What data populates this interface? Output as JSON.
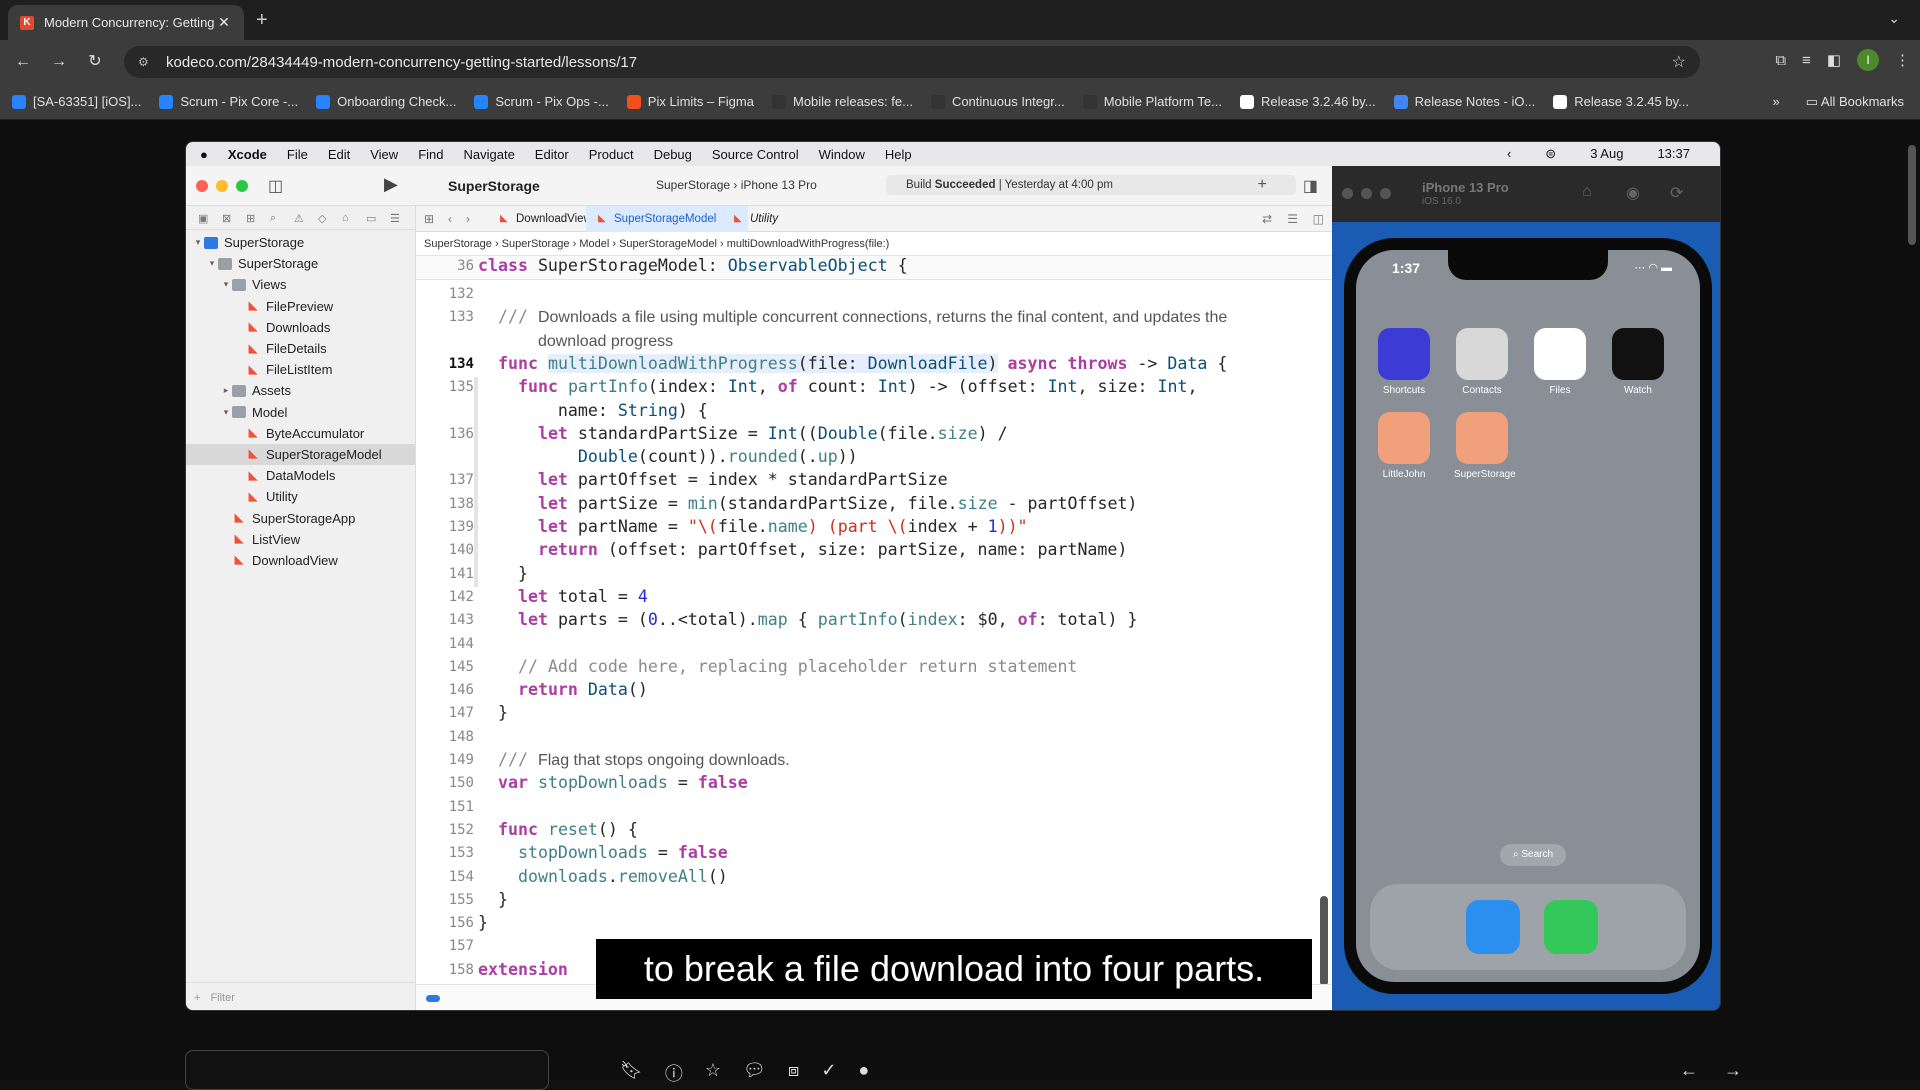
{
  "browser": {
    "tab_title": "Modern Concurrency: Getting",
    "url": "kodeco.com/28434449-modern-concurrency-getting-started/lessons/17",
    "bookmarks": [
      {
        "label": "[SA-63351] [iOS]...",
        "color": "#2684ff"
      },
      {
        "label": "Scrum - Pix Core -...",
        "color": "#2684ff"
      },
      {
        "label": "Onboarding Check...",
        "color": "#2684ff"
      },
      {
        "label": "Scrum - Pix Ops -...",
        "color": "#2684ff"
      },
      {
        "label": "Pix Limits – Figma",
        "color": "#f24e1e"
      },
      {
        "label": "Mobile releases: fe...",
        "color": "#333333"
      },
      {
        "label": "Continuous Integr...",
        "color": "#333333"
      },
      {
        "label": "Mobile Platform Te...",
        "color": "#333333"
      },
      {
        "label": "Release 3.2.46 by...",
        "color": "#ffffff"
      },
      {
        "label": "Release Notes - iO...",
        "color": "#4285f4"
      },
      {
        "label": "Release 3.2.45 by...",
        "color": "#ffffff"
      }
    ],
    "all_bookmarks": "All Bookmarks",
    "avatar_letter": "I"
  },
  "mac_menu": {
    "app": "Xcode",
    "items": [
      "File",
      "Edit",
      "View",
      "Find",
      "Navigate",
      "Editor",
      "Product",
      "Debug",
      "Source Control",
      "Window",
      "Help"
    ],
    "date": "3 Aug",
    "time": "13:37"
  },
  "xcode": {
    "project": "SuperStorage",
    "scheme": "SuperStorage",
    "device": "iPhone 13 Pro",
    "build_prefix": "Build ",
    "build_status": "Succeeded",
    "build_time": " | Yesterday at 4:00 pm",
    "tabs": [
      "DownloadView",
      "SuperStorageModel",
      "Utility"
    ],
    "breadcrumb": [
      "SuperStorage",
      "SuperStorage",
      "Model",
      "SuperStorageModel",
      "multiDownloadWithProgress(file:)"
    ],
    "filter_placeholder": "Filter",
    "navigator": [
      {
        "label": "SuperStorage",
        "depth": 0,
        "kind": "project",
        "open": true
      },
      {
        "label": "SuperStorage",
        "depth": 1,
        "kind": "folder",
        "open": true
      },
      {
        "label": "Views",
        "depth": 2,
        "kind": "folder",
        "open": true
      },
      {
        "label": "FilePreview",
        "depth": 3,
        "kind": "swift"
      },
      {
        "label": "Downloads",
        "depth": 3,
        "kind": "swift"
      },
      {
        "label": "FileDetails",
        "depth": 3,
        "kind": "swift"
      },
      {
        "label": "FileListItem",
        "depth": 3,
        "kind": "swift"
      },
      {
        "label": "Assets",
        "depth": 2,
        "kind": "folder",
        "open": false
      },
      {
        "label": "Model",
        "depth": 2,
        "kind": "folder",
        "open": true
      },
      {
        "label": "ByteAccumulator",
        "depth": 3,
        "kind": "swift"
      },
      {
        "label": "SuperStorageModel",
        "depth": 3,
        "kind": "swift",
        "selected": true
      },
      {
        "label": "DataModels",
        "depth": 3,
        "kind": "swift"
      },
      {
        "label": "Utility",
        "depth": 3,
        "kind": "swift"
      },
      {
        "label": "SuperStorageApp",
        "depth": 2,
        "kind": "swift"
      },
      {
        "label": "ListView",
        "depth": 2,
        "kind": "swift"
      },
      {
        "label": "DownloadView",
        "depth": 2,
        "kind": "swift"
      }
    ],
    "sticky_line": {
      "n": "36",
      "text": "class SuperStorageModel: ObservableObject {"
    },
    "code_lines": [
      {
        "n": "132",
        "html": ""
      },
      {
        "n": "133",
        "html": "  <span class='cm'>///</span> <span class='doc'>Downloads a file using multiple concurrent connections, returns the final content, and updates the</span>"
      },
      {
        "n": "",
        "html": "      <span class='doc'>download progress</span>"
      },
      {
        "n": "134",
        "html": "  <span class='kw'>func</span> <span class='hl'><span class='fn'>multiDownloadWithProgress</span>(file: <span class='ty'>DownloadFile</span>)</span> <span class='kw'>async throws</span> -&gt; <span class='ty'>Data</span> {",
        "cur": true
      },
      {
        "n": "135",
        "html": "    <span class='kw'>func</span> <span class='fn'>partInfo</span>(index: <span class='ty'>Int</span>, <span class='kw'>of</span> count: <span class='ty'>Int</span>) -&gt; (offset: <span class='ty'>Int</span>, size: <span class='ty'>Int</span>,"
      },
      {
        "n": "",
        "html": "        name: <span class='ty'>String</span>) {"
      },
      {
        "n": "136",
        "html": "      <span class='kw'>let</span> standardPartSize = <span class='ty'>Int</span>((<span class='ty'>Double</span>(file.<span class='pr'>size</span>) /"
      },
      {
        "n": "",
        "html": "          <span class='ty'>Double</span>(count)).<span class='pr'>rounded</span>(.<span class='pr'>up</span>))"
      },
      {
        "n": "137",
        "html": "      <span class='kw'>let</span> partOffset = index * standardPartSize"
      },
      {
        "n": "138",
        "html": "      <span class='kw'>let</span> partSize = <span class='pr'>min</span>(standardPartSize, file.<span class='pr'>size</span> - partOffset)"
      },
      {
        "n": "139",
        "html": "      <span class='kw'>let</span> partName = <span class='str'>\"\\(</span>file.<span class='pr'>name</span><span class='str'>) (part \\(</span>index + <span class='num'>1</span><span class='str'>))\"</span>"
      },
      {
        "n": "140",
        "html": "      <span class='kw'>return</span> (offset: partOffset, size: partSize, name: partName)"
      },
      {
        "n": "141",
        "html": "    }"
      },
      {
        "n": "142",
        "html": "    <span class='kw'>let</span> total = <span class='num'>4</span>"
      },
      {
        "n": "143",
        "html": "    <span class='kw'>let</span> parts = (<span class='num'>0</span>..&lt;total).<span class='pr'>map</span> { <span class='fn'>partInfo</span>(<span class='pr'>index</span>: $0, <span class='kw'>of</span>: total) }"
      },
      {
        "n": "144",
        "html": ""
      },
      {
        "n": "145",
        "html": "    <span class='cm'>// Add code here, replacing placeholder return statement</span>"
      },
      {
        "n": "146",
        "html": "    <span class='kw'>return</span> <span class='ty'>Data</span>()"
      },
      {
        "n": "147",
        "html": "  }"
      },
      {
        "n": "148",
        "html": ""
      },
      {
        "n": "149",
        "html": "  <span class='cm'>///</span> <span class='doc'>Flag that stops ongoing downloads.</span>"
      },
      {
        "n": "150",
        "html": "  <span class='kw'>var</span> <span class='pr'>stopDownloads</span> = <span class='kw'>false</span>"
      },
      {
        "n": "151",
        "html": ""
      },
      {
        "n": "152",
        "html": "  <span class='kw'>func</span> <span class='fn'>reset</span>() {"
      },
      {
        "n": "153",
        "html": "    <span class='pr'>stopDownloads</span> = <span class='kw'>false</span>"
      },
      {
        "n": "154",
        "html": "    <span class='pr'>downloads</span>.<span class='pr'>removeAll</span>()"
      },
      {
        "n": "155",
        "html": "  }"
      },
      {
        "n": "156",
        "html": "}"
      },
      {
        "n": "157",
        "html": ""
      },
      {
        "n": "158",
        "html": "<span class='kw'>extension</span>"
      }
    ]
  },
  "caption": "to break a file download into four parts.",
  "simulator": {
    "device": "iPhone 13 Pro",
    "os": "iOS 16.0",
    "time": "1:37",
    "apps": [
      {
        "label": "Shortcuts",
        "color": "#3b3bd6"
      },
      {
        "label": "Contacts",
        "color": "#d8d8d8"
      },
      {
        "label": "Files",
        "color": "#ffffff"
      },
      {
        "label": "Watch",
        "color": "#111111"
      },
      {
        "label": "LittleJohn",
        "color": "#f0a07a"
      },
      {
        "label": "SuperStorage",
        "color": "#f0a07a"
      }
    ],
    "search": "Search",
    "dock": [
      {
        "name": "Safari",
        "color": "#2b8ff0"
      },
      {
        "name": "Messages",
        "color": "#34c759"
      }
    ]
  }
}
